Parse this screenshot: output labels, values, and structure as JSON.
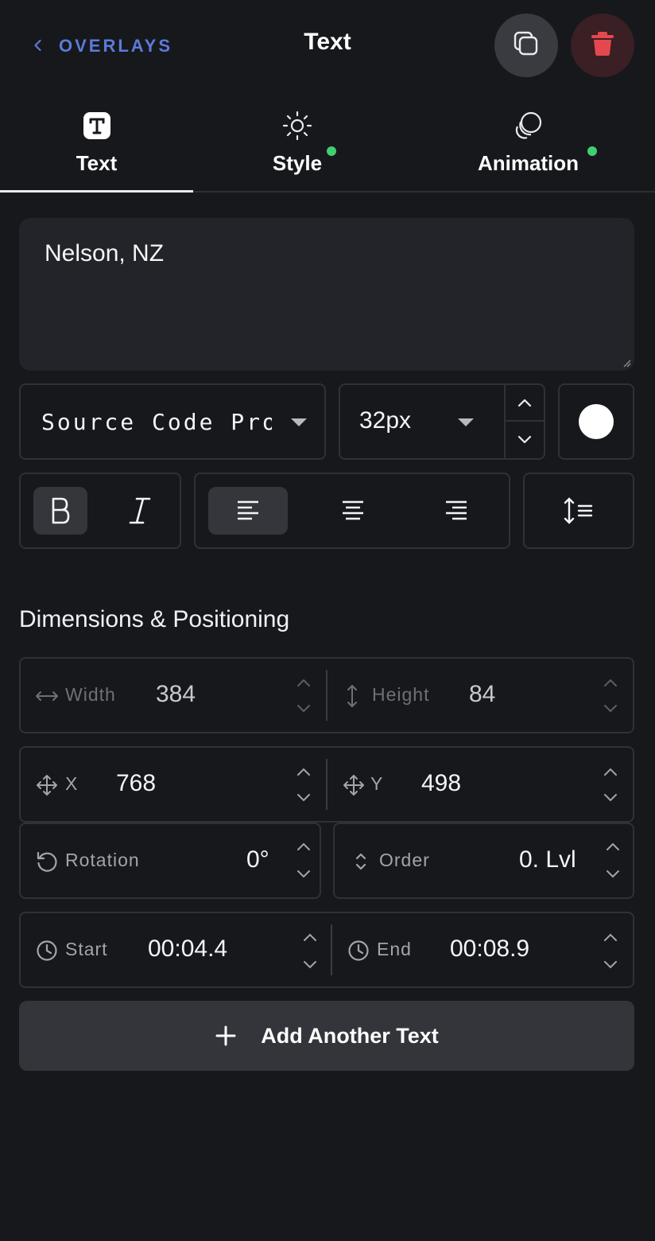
{
  "header": {
    "back_label": "OVERLAYS",
    "title": "Text"
  },
  "tabs": [
    {
      "label": "Text",
      "icon": "text-box-icon",
      "active": true,
      "has_dot": false
    },
    {
      "label": "Style",
      "icon": "sun-icon",
      "active": false,
      "has_dot": true
    },
    {
      "label": "Animation",
      "icon": "bubbles-icon",
      "active": false,
      "has_dot": true
    }
  ],
  "text_content": "Nelson, NZ",
  "font": {
    "family": "Source Code Pro",
    "size": "32px",
    "color": "#ffffff"
  },
  "format": {
    "bold_active": true,
    "italic_active": false,
    "align": "left"
  },
  "section_title": "Dimensions & Positioning",
  "fields": {
    "width": {
      "label": "Width",
      "value": "384"
    },
    "height": {
      "label": "Height",
      "value": "84"
    },
    "x": {
      "label": "X",
      "value": "768"
    },
    "y": {
      "label": "Y",
      "value": "498"
    },
    "rotation": {
      "label": "Rotation",
      "value": "0°"
    },
    "order": {
      "label": "Order",
      "value": "0. Lvl"
    },
    "start": {
      "label": "Start",
      "value": "00:04.4"
    },
    "end": {
      "label": "End",
      "value": "00:08.9"
    }
  },
  "add_button_label": "Add Another Text",
  "colors": {
    "accent_link": "#5b7bd8",
    "status_dot": "#3fcf72",
    "delete_icon": "#e5484d",
    "background": "#17181c"
  }
}
